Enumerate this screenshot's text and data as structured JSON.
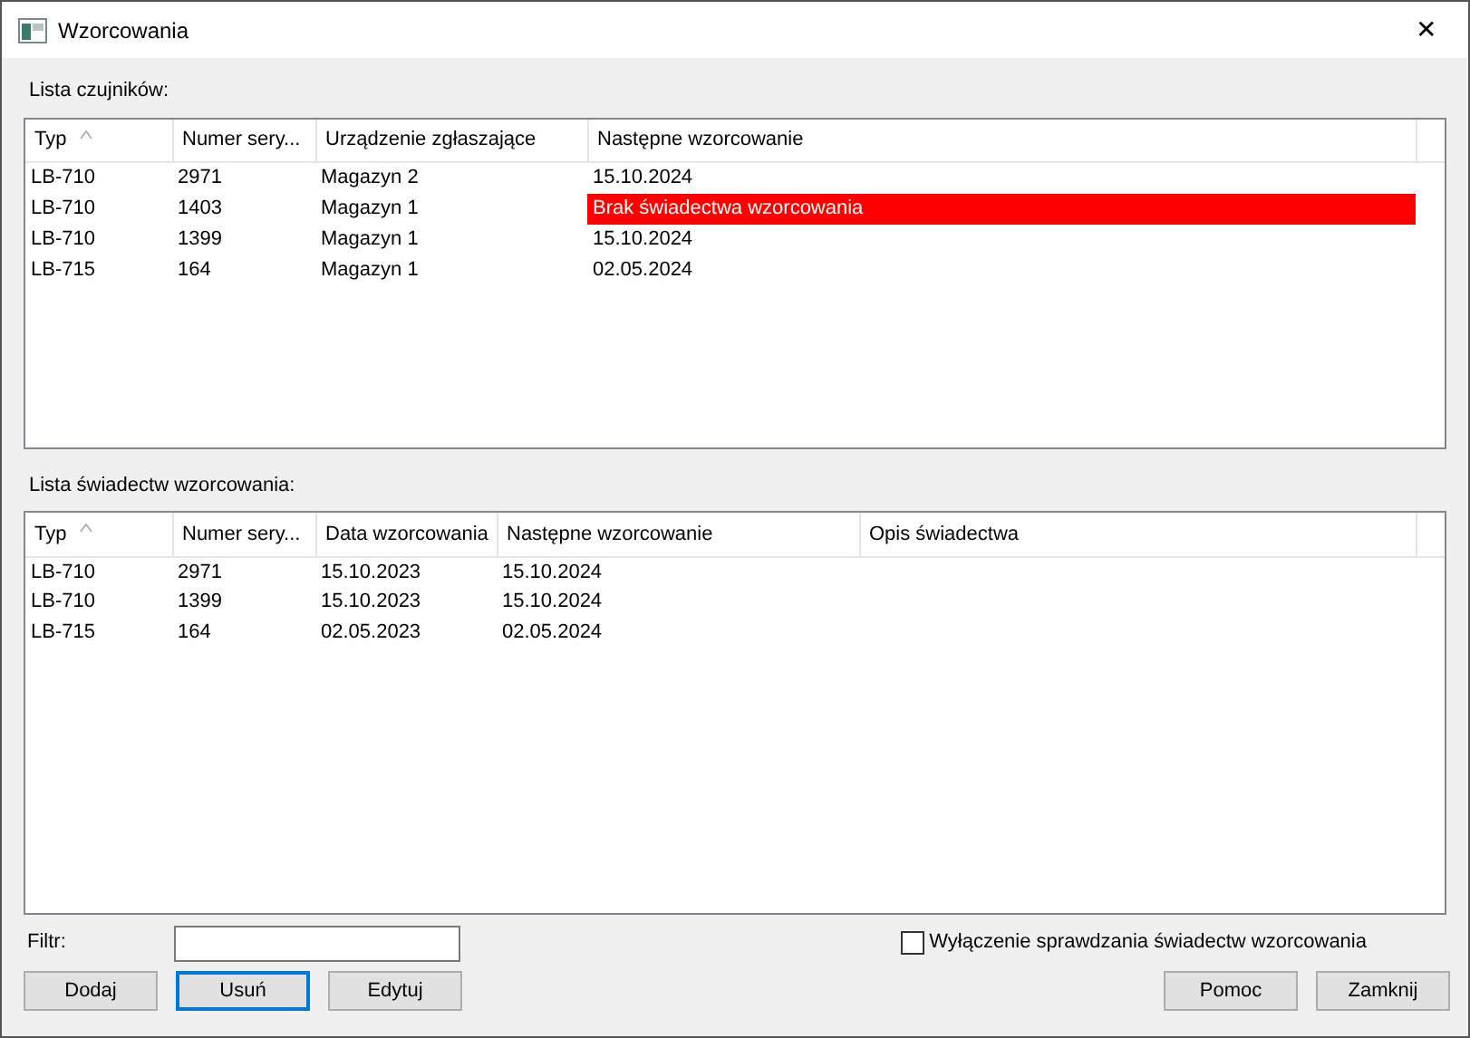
{
  "window": {
    "title": "Wzorcowania",
    "close": "✕"
  },
  "sensors": {
    "label": "Lista czujników:",
    "columns": [
      {
        "label": "Typ",
        "sorted": true
      },
      {
        "label": "Numer sery...",
        "sorted": false
      },
      {
        "label": "Urządzenie zgłaszające",
        "sorted": false
      },
      {
        "label": "Następne wzorcowanie",
        "sorted": false
      }
    ],
    "rows": [
      {
        "cells": [
          "LB-710",
          "2971",
          "Magazyn 2",
          "15.10.2024"
        ],
        "alert": false
      },
      {
        "cells": [
          "LB-710",
          "1403",
          "Magazyn 1",
          "Brak świadectwa wzorcowania"
        ],
        "alert": true
      },
      {
        "cells": [
          "LB-710",
          "1399",
          "Magazyn 1",
          "15.10.2024"
        ],
        "alert": false
      },
      {
        "cells": [
          "LB-715",
          "164",
          "Magazyn 1",
          "02.05.2024"
        ],
        "alert": false
      }
    ]
  },
  "certificates": {
    "label": "Lista świadectw wzorcowania:",
    "columns": [
      {
        "label": "Typ",
        "sorted": true
      },
      {
        "label": "Numer sery...",
        "sorted": false
      },
      {
        "label": "Data wzorcowania",
        "sorted": false
      },
      {
        "label": "Następne wzorcowanie",
        "sorted": false
      },
      {
        "label": "Opis świadectwa",
        "sorted": false
      }
    ],
    "rows": [
      {
        "cells": [
          "LB-710",
          "2971",
          "15.10.2023",
          "15.10.2024"
        ]
      },
      {
        "cells": [
          "LB-710",
          "1399",
          "15.10.2023",
          "15.10.2024"
        ]
      },
      {
        "cells": [
          "LB-715",
          "164",
          "02.05.2023",
          "02.05.2024"
        ]
      }
    ]
  },
  "filter": {
    "label": "Filtr:"
  },
  "disable_check": {
    "label": "Wyłączenie sprawdzania świadectw wzorcowania",
    "checked": false
  },
  "buttons_left": [
    {
      "label": "Dodaj",
      "focused": false
    },
    {
      "label": "Usuń",
      "focused": true
    },
    {
      "label": "Edytuj",
      "focused": false
    }
  ],
  "buttons_right": [
    {
      "label": "Pomoc",
      "focused": false
    },
    {
      "label": "Zamknij",
      "focused": false
    }
  ]
}
